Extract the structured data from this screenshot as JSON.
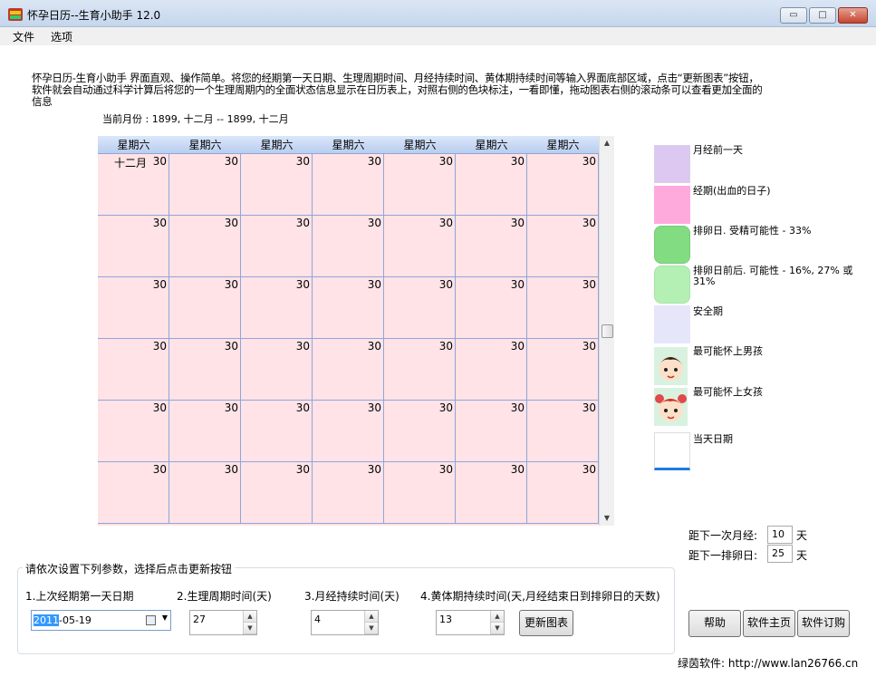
{
  "window": {
    "title": "怀孕日历--生育小助手 12.0",
    "minimize": "▭",
    "maximize": "□",
    "close": "✕"
  },
  "menu": [
    "文件",
    "选项"
  ],
  "description": "怀孕日历-生育小助手 界面直观、操作简单。将您的经期第一天日期、生理周期时间、月经持续时间、黄体期持续时间等输入界面底部区域，点击“更新图表”按钮，软件就会自动通过科学计算后将您的一个生理周期内的全面状态信息显示在日历表上，对照右侧的色块标注，一看即懂，拖动图表右侧的滚动条可以查看更加全面的信息",
  "current_month": "当前月份 : 1899, 十二月 -- 1899, 十二月",
  "calendar": {
    "headers": [
      "星期六",
      "星期六",
      "星期六",
      "星期六",
      "星期六",
      "星期六",
      "星期六"
    ],
    "month_label": "十二月",
    "rows": [
      [
        "30",
        "30",
        "30",
        "30",
        "30",
        "30",
        "30"
      ],
      [
        "30",
        "30",
        "30",
        "30",
        "30",
        "30",
        "30"
      ],
      [
        "30",
        "30",
        "30",
        "30",
        "30",
        "30",
        "30"
      ],
      [
        "30",
        "30",
        "30",
        "30",
        "30",
        "30",
        "30"
      ],
      [
        "30",
        "30",
        "30",
        "30",
        "30",
        "30",
        "30"
      ],
      [
        "30",
        "30",
        "30",
        "30",
        "30",
        "30",
        "30"
      ]
    ],
    "cell_color": "#ffe3e6"
  },
  "legend": [
    {
      "label": "月经前一天",
      "color": "#dcc8f0"
    },
    {
      "label": "经期(出血的日子)",
      "color": "#ffaadc"
    },
    {
      "label": "排卵日. 受精可能性 - 33%",
      "color": "#82dc82"
    },
    {
      "label": "排卵日前后. 可能性 - 16%, 27% 或 31%",
      "color": "#b4f0b4"
    },
    {
      "label": "安全期",
      "color": "#e6e6fa"
    },
    {
      "label": "最可能怀上男孩",
      "icon": "boy-face-icon"
    },
    {
      "label": "最可能怀上女孩",
      "icon": "girl-face-icon"
    },
    {
      "label": "当天日期",
      "color": "#ffffff",
      "accent": "#1e7be0"
    }
  ],
  "distance": {
    "period_label": "距下一次月经:",
    "period_value": "10",
    "ovulation_label": "距下一排卵日:",
    "ovulation_value": "25",
    "unit": "天"
  },
  "params": {
    "group_title": "请依次设置下列参数，选择后点击更新按钮",
    "labels": [
      "1.上次经期第一天日期",
      "2.生理周期时间(天)",
      "3.月经持续时间(天)",
      "4.黄体期持续时间(天,月经结束日到排卵日的天数)"
    ],
    "date_year": "2011",
    "date_rest": "-05-19",
    "cycle_days": "27",
    "period_days": "4",
    "luteal_days": "13",
    "update_button": "更新图表"
  },
  "buttons": {
    "help": "帮助",
    "homepage": "软件主页",
    "order": "软件订购"
  },
  "site": "绿茵软件: http://www.lan26766.cn"
}
